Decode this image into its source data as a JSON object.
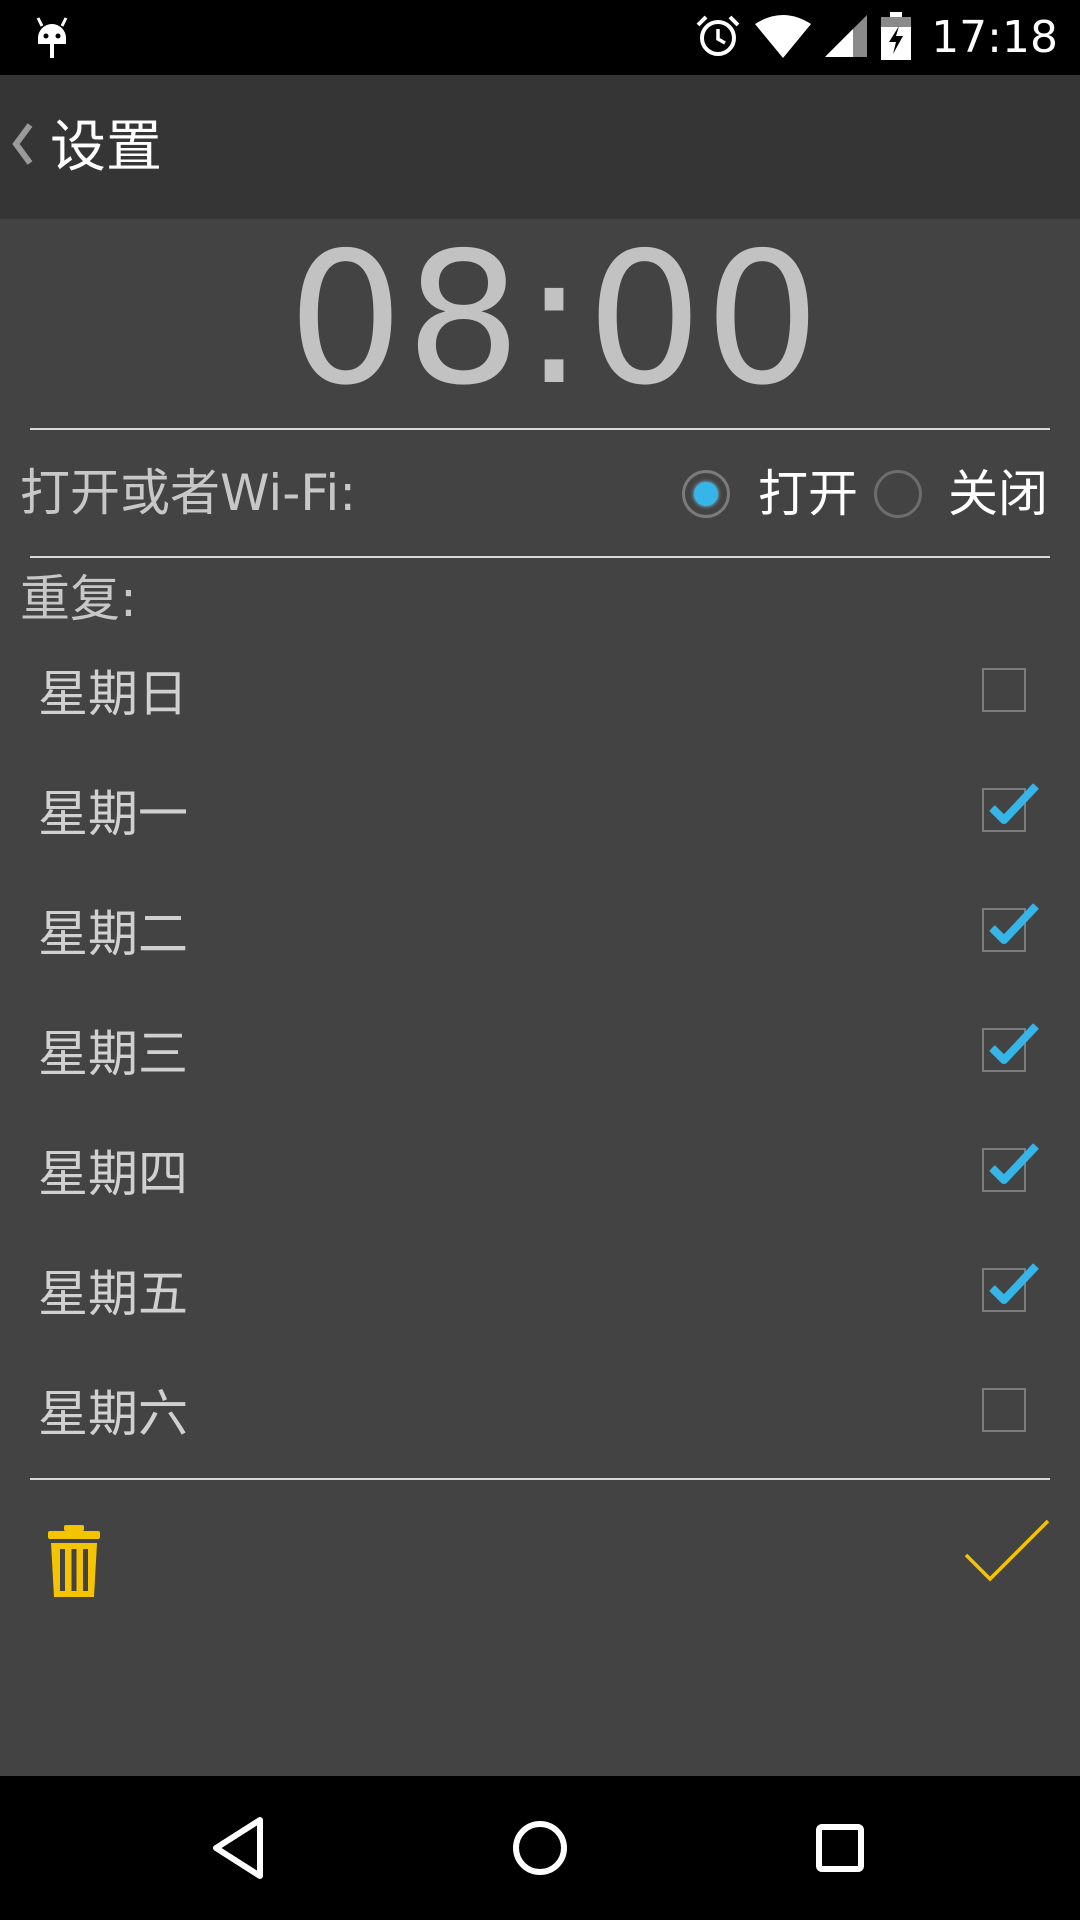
{
  "status_bar": {
    "time": "17:18",
    "icons": [
      "android-icon",
      "alarm-icon",
      "wifi-icon",
      "signal-icon",
      "battery-charging-icon"
    ]
  },
  "action_bar": {
    "back_icon": "chevron-left-icon",
    "title": "设置"
  },
  "alarm": {
    "time": "08:00"
  },
  "wifi": {
    "label": "打开或者Wi-Fi:",
    "options": [
      {
        "label": "打开",
        "checked": true
      },
      {
        "label": "关闭",
        "checked": false
      }
    ]
  },
  "repeat": {
    "label": "重复:",
    "days": [
      {
        "label": "星期日",
        "checked": false
      },
      {
        "label": "星期一",
        "checked": true
      },
      {
        "label": "星期二",
        "checked": true
      },
      {
        "label": "星期三",
        "checked": true
      },
      {
        "label": "星期四",
        "checked": true
      },
      {
        "label": "星期五",
        "checked": true
      },
      {
        "label": "星期六",
        "checked": false
      }
    ]
  },
  "actions": {
    "delete_icon": "trash-icon",
    "confirm_icon": "checkmark-icon"
  },
  "nav_bar": {
    "icons": [
      "back-triangle-icon",
      "home-circle-icon",
      "recents-square-icon"
    ]
  },
  "colors": {
    "background": "#434343",
    "action_bar": "#353535",
    "accent_blue": "#36b5e8",
    "accent_yellow": "#f5c400"
  }
}
